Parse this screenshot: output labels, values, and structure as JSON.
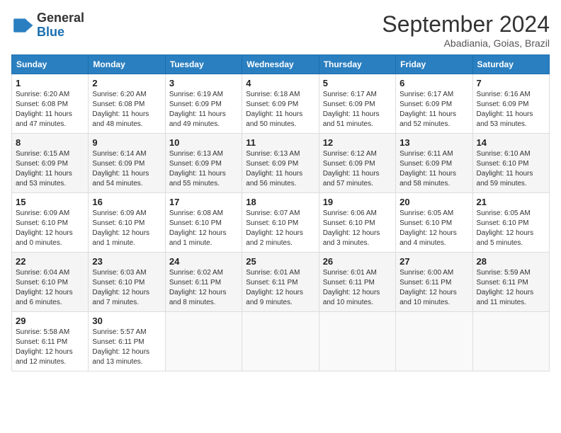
{
  "header": {
    "logo": {
      "general": "General",
      "blue": "Blue"
    },
    "title": "September 2024",
    "subtitle": "Abadiania, Goias, Brazil"
  },
  "calendar": {
    "days_of_week": [
      "Sunday",
      "Monday",
      "Tuesday",
      "Wednesday",
      "Thursday",
      "Friday",
      "Saturday"
    ],
    "weeks": [
      [
        {
          "day": "1",
          "info": "Sunrise: 6:20 AM\nSunset: 6:08 PM\nDaylight: 11 hours\nand 47 minutes."
        },
        {
          "day": "2",
          "info": "Sunrise: 6:20 AM\nSunset: 6:08 PM\nDaylight: 11 hours\nand 48 minutes."
        },
        {
          "day": "3",
          "info": "Sunrise: 6:19 AM\nSunset: 6:09 PM\nDaylight: 11 hours\nand 49 minutes."
        },
        {
          "day": "4",
          "info": "Sunrise: 6:18 AM\nSunset: 6:09 PM\nDaylight: 11 hours\nand 50 minutes."
        },
        {
          "day": "5",
          "info": "Sunrise: 6:17 AM\nSunset: 6:09 PM\nDaylight: 11 hours\nand 51 minutes."
        },
        {
          "day": "6",
          "info": "Sunrise: 6:17 AM\nSunset: 6:09 PM\nDaylight: 11 hours\nand 52 minutes."
        },
        {
          "day": "7",
          "info": "Sunrise: 6:16 AM\nSunset: 6:09 PM\nDaylight: 11 hours\nand 53 minutes."
        }
      ],
      [
        {
          "day": "8",
          "info": "Sunrise: 6:15 AM\nSunset: 6:09 PM\nDaylight: 11 hours\nand 53 minutes."
        },
        {
          "day": "9",
          "info": "Sunrise: 6:14 AM\nSunset: 6:09 PM\nDaylight: 11 hours\nand 54 minutes."
        },
        {
          "day": "10",
          "info": "Sunrise: 6:13 AM\nSunset: 6:09 PM\nDaylight: 11 hours\nand 55 minutes."
        },
        {
          "day": "11",
          "info": "Sunrise: 6:13 AM\nSunset: 6:09 PM\nDaylight: 11 hours\nand 56 minutes."
        },
        {
          "day": "12",
          "info": "Sunrise: 6:12 AM\nSunset: 6:09 PM\nDaylight: 11 hours\nand 57 minutes."
        },
        {
          "day": "13",
          "info": "Sunrise: 6:11 AM\nSunset: 6:09 PM\nDaylight: 11 hours\nand 58 minutes."
        },
        {
          "day": "14",
          "info": "Sunrise: 6:10 AM\nSunset: 6:10 PM\nDaylight: 11 hours\nand 59 minutes."
        }
      ],
      [
        {
          "day": "15",
          "info": "Sunrise: 6:09 AM\nSunset: 6:10 PM\nDaylight: 12 hours\nand 0 minutes."
        },
        {
          "day": "16",
          "info": "Sunrise: 6:09 AM\nSunset: 6:10 PM\nDaylight: 12 hours\nand 1 minute."
        },
        {
          "day": "17",
          "info": "Sunrise: 6:08 AM\nSunset: 6:10 PM\nDaylight: 12 hours\nand 1 minute."
        },
        {
          "day": "18",
          "info": "Sunrise: 6:07 AM\nSunset: 6:10 PM\nDaylight: 12 hours\nand 2 minutes."
        },
        {
          "day": "19",
          "info": "Sunrise: 6:06 AM\nSunset: 6:10 PM\nDaylight: 12 hours\nand 3 minutes."
        },
        {
          "day": "20",
          "info": "Sunrise: 6:05 AM\nSunset: 6:10 PM\nDaylight: 12 hours\nand 4 minutes."
        },
        {
          "day": "21",
          "info": "Sunrise: 6:05 AM\nSunset: 6:10 PM\nDaylight: 12 hours\nand 5 minutes."
        }
      ],
      [
        {
          "day": "22",
          "info": "Sunrise: 6:04 AM\nSunset: 6:10 PM\nDaylight: 12 hours\nand 6 minutes."
        },
        {
          "day": "23",
          "info": "Sunrise: 6:03 AM\nSunset: 6:10 PM\nDaylight: 12 hours\nand 7 minutes."
        },
        {
          "day": "24",
          "info": "Sunrise: 6:02 AM\nSunset: 6:11 PM\nDaylight: 12 hours\nand 8 minutes."
        },
        {
          "day": "25",
          "info": "Sunrise: 6:01 AM\nSunset: 6:11 PM\nDaylight: 12 hours\nand 9 minutes."
        },
        {
          "day": "26",
          "info": "Sunrise: 6:01 AM\nSunset: 6:11 PM\nDaylight: 12 hours\nand 10 minutes."
        },
        {
          "day": "27",
          "info": "Sunrise: 6:00 AM\nSunset: 6:11 PM\nDaylight: 12 hours\nand 10 minutes."
        },
        {
          "day": "28",
          "info": "Sunrise: 5:59 AM\nSunset: 6:11 PM\nDaylight: 12 hours\nand 11 minutes."
        }
      ],
      [
        {
          "day": "29",
          "info": "Sunrise: 5:58 AM\nSunset: 6:11 PM\nDaylight: 12 hours\nand 12 minutes."
        },
        {
          "day": "30",
          "info": "Sunrise: 5:57 AM\nSunset: 6:11 PM\nDaylight: 12 hours\nand 13 minutes."
        },
        {
          "day": "",
          "info": ""
        },
        {
          "day": "",
          "info": ""
        },
        {
          "day": "",
          "info": ""
        },
        {
          "day": "",
          "info": ""
        },
        {
          "day": "",
          "info": ""
        }
      ]
    ]
  }
}
